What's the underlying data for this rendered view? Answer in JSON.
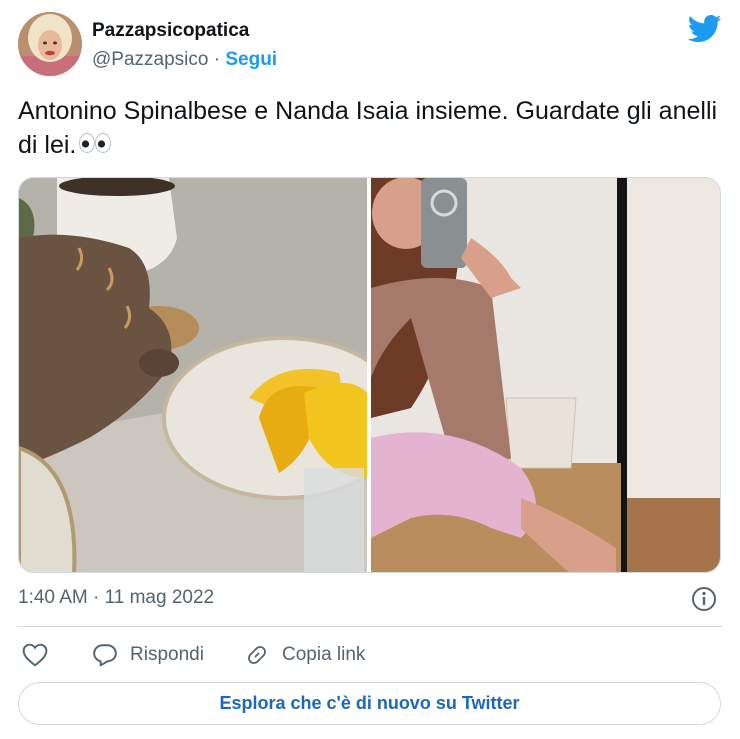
{
  "author": {
    "display_name": "Pazzapsicopatica",
    "handle": "@Pazzapsico",
    "separator": "·",
    "follow_label": "Segui"
  },
  "tweet": {
    "text": "Antonino Spinalbese e Nanda Isaia insieme. Guardate gli anelli di lei.",
    "emoji_icon": "eyes-emoji-icon",
    "timestamp": "1:40 AM · 11 mag 2022"
  },
  "media": {
    "photos": [
      {
        "name": "photo-hand-with-rings",
        "subject": "hand with rings, teacup, lemons on plate"
      },
      {
        "name": "photo-mirror-selfie",
        "subject": "mirror selfie in pink outfit"
      }
    ]
  },
  "actions": {
    "like_icon": "heart-icon",
    "reply_label": "Rispondi",
    "reply_icon": "speech-bubble-icon",
    "copy_label": "Copia link",
    "copy_icon": "link-icon"
  },
  "cta": {
    "explore_label": "Esplora che c'è di nuovo su Twitter"
  },
  "colors": {
    "twitter_blue": "#1d9bf0",
    "cta_text": "#1d68b9",
    "secondary_text": "#536471",
    "border": "#cfd9de"
  }
}
